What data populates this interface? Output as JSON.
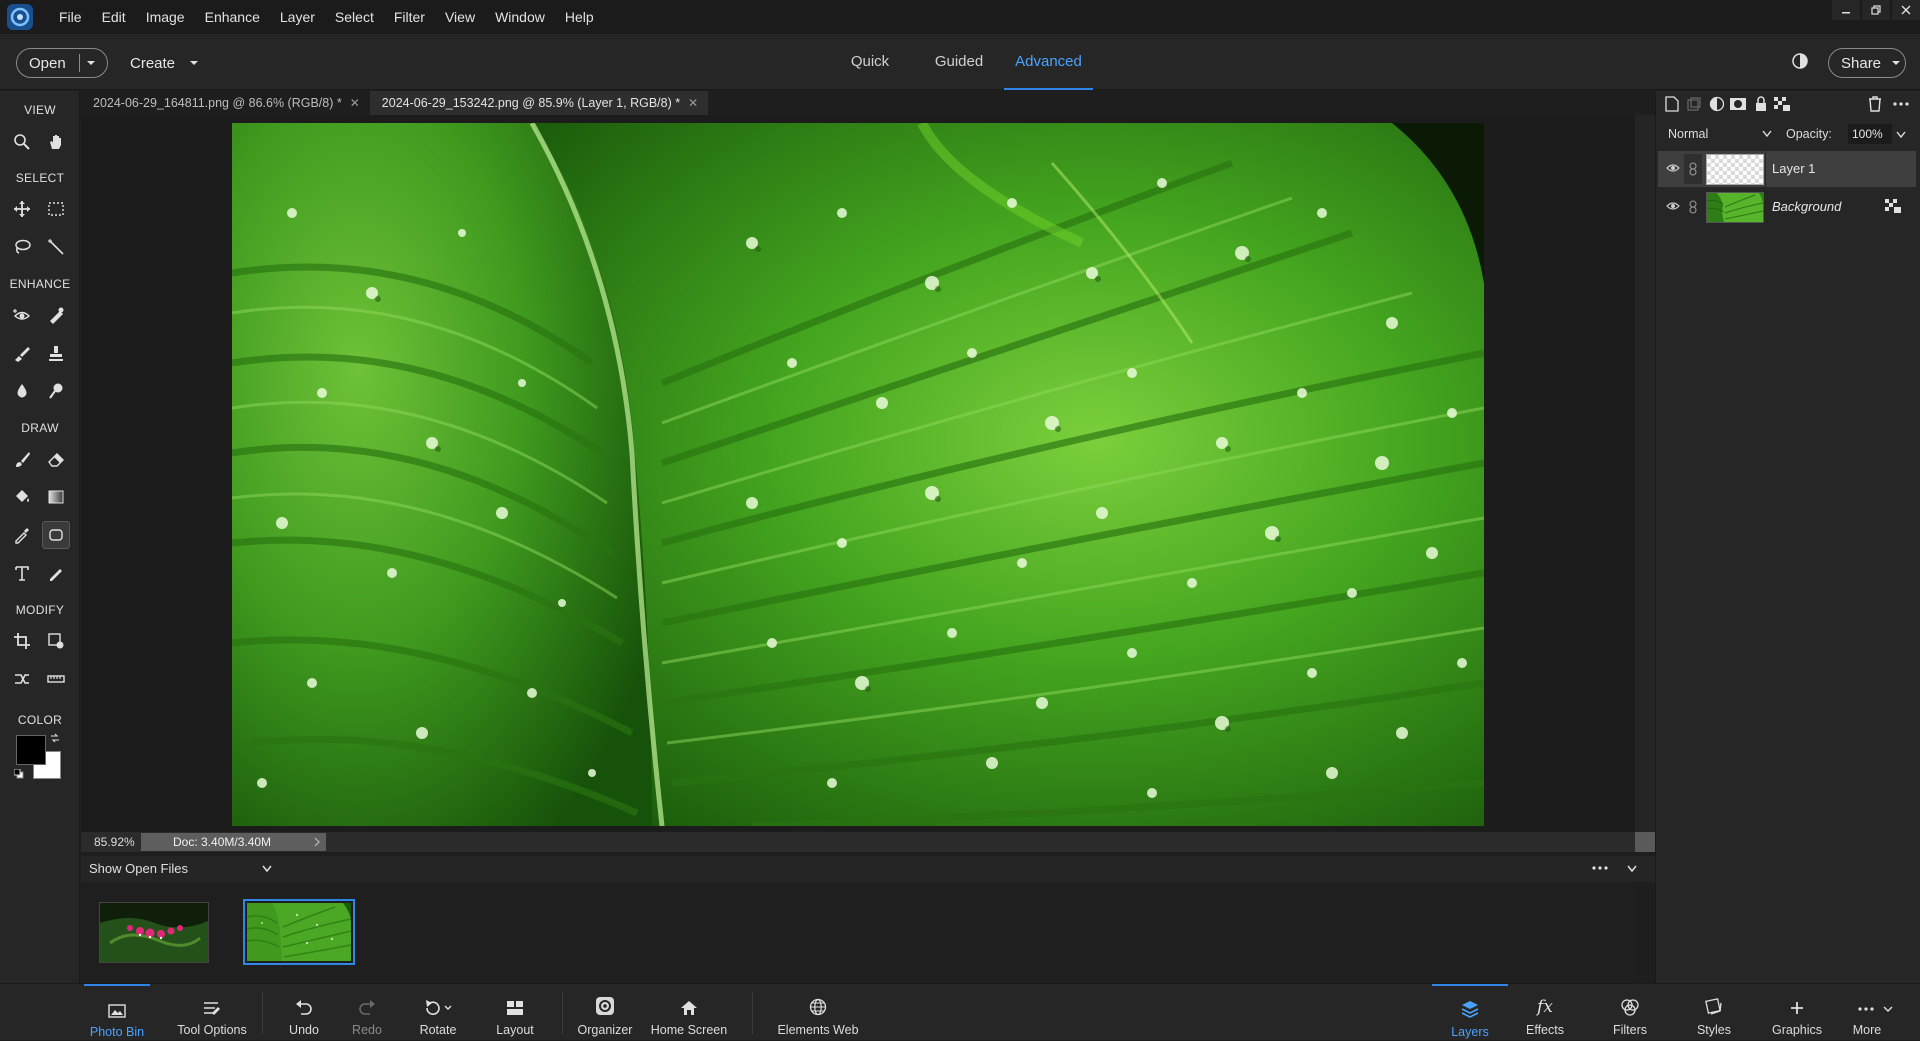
{
  "menu": [
    "File",
    "Edit",
    "Image",
    "Enhance",
    "Layer",
    "Select",
    "Filter",
    "View",
    "Window",
    "Help"
  ],
  "modebar": {
    "open_label": "Open",
    "create_label": "Create",
    "tabs": [
      "Quick",
      "Guided",
      "Advanced"
    ],
    "active_tab": "Advanced",
    "share_label": "Share"
  },
  "toolbox": {
    "sections": [
      "VIEW",
      "SELECT",
      "ENHANCE",
      "DRAW",
      "MODIFY",
      "COLOR"
    ],
    "foreground_color": "#000000",
    "background_color": "#ffffff"
  },
  "documents": [
    {
      "title": "2024-06-29_164811.png @ 86.6% (RGB/8) *",
      "active": false
    },
    {
      "title": "2024-06-29_153242.png @ 85.9% (Layer 1, RGB/8) *",
      "active": true
    }
  ],
  "status": {
    "zoom": "85.92%",
    "doc_info": "Doc: 3.40M/3.40M"
  },
  "photo_bin": {
    "source_label": "Show Open Files"
  },
  "layers_panel": {
    "blend_mode": "Normal",
    "opacity_label": "Opacity:",
    "opacity_value": "100%",
    "layers": [
      {
        "name": "Layer 1",
        "selected": true
      },
      {
        "name": "Background",
        "selected": false
      }
    ]
  },
  "taskbar": {
    "left": [
      {
        "label": "Photo Bin",
        "icon": "photo-bin-icon",
        "active": true
      },
      {
        "label": "Tool Options",
        "icon": "tool-options-icon"
      },
      {
        "label": "Undo",
        "icon": "undo-icon"
      },
      {
        "label": "Redo",
        "icon": "redo-icon",
        "disabled": true
      },
      {
        "label": "Rotate",
        "icon": "rotate-icon"
      },
      {
        "label": "Layout",
        "icon": "layout-icon"
      },
      {
        "label": "Organizer",
        "icon": "organizer-icon"
      },
      {
        "label": "Home Screen",
        "icon": "home-icon"
      },
      {
        "label": "Elements Web",
        "icon": "globe-icon"
      }
    ],
    "right": [
      {
        "label": "Layers",
        "icon": "layers-icon",
        "active": true
      },
      {
        "label": "Effects",
        "icon": "fx-icon"
      },
      {
        "label": "Filters",
        "icon": "filters-icon"
      },
      {
        "label": "Styles",
        "icon": "styles-icon"
      },
      {
        "label": "Graphics",
        "icon": "plus-icon"
      },
      {
        "label": "More",
        "icon": "more-icon"
      }
    ]
  },
  "colors": {
    "accent": "#2f86e8",
    "accent_text": "#4aa3ff",
    "panel": "#262626",
    "canvas": "#1c1c1c"
  }
}
